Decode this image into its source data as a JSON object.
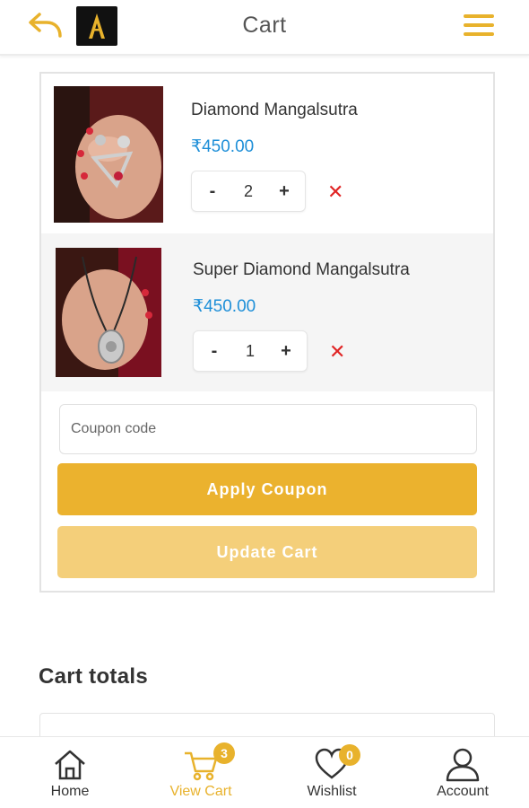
{
  "header": {
    "title": "Cart",
    "back_icon": "back-arrow-icon",
    "menu_icon": "hamburger-menu-icon",
    "logo_icon": "brand-logo-icon",
    "accent_color": "#e8b22c"
  },
  "cart": {
    "items": [
      {
        "name": "Diamond Mangalsutra",
        "price": "₹450.00",
        "quantity": "2",
        "minus": "-",
        "plus": "+",
        "remove": "✕"
      },
      {
        "name": "Super Diamond Mangalsutra",
        "price": "₹450.00",
        "quantity": "1",
        "minus": "-",
        "plus": "+",
        "remove": "✕"
      }
    ],
    "coupon_placeholder": "Coupon code",
    "apply_label": "Apply Coupon",
    "update_label": "Update Cart"
  },
  "totals": {
    "heading": "Cart totals"
  },
  "nav": {
    "items": [
      {
        "label": "Home",
        "icon": "home-icon"
      },
      {
        "label": "View Cart",
        "icon": "cart-icon",
        "badge": "3"
      },
      {
        "label": "Wishlist",
        "icon": "heart-icon",
        "badge": "0"
      },
      {
        "label": "Account",
        "icon": "user-icon"
      }
    ]
  },
  "colors": {
    "accent": "#e8b22c",
    "price": "#1e8fd8",
    "remove": "#e02424",
    "update_button": "#f4cf7a"
  }
}
